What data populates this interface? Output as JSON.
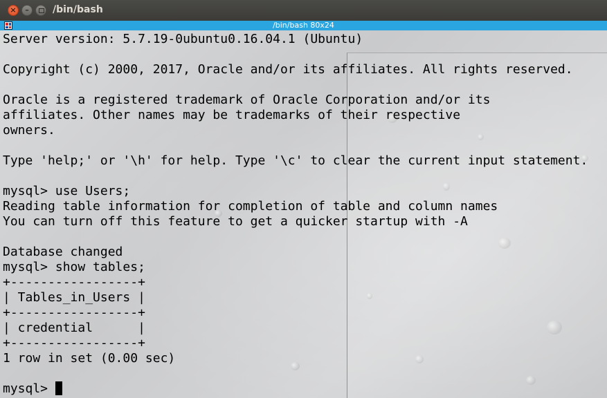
{
  "window": {
    "title": "/bin/bash",
    "close_glyph": "×",
    "minimize_glyph": "–",
    "icons": [
      "close-icon",
      "minimize-icon",
      "maximize-icon"
    ]
  },
  "terminal_bar": {
    "title": "/bin/bash 80x24",
    "icon": "terminal-app-icon",
    "color": "#2aa5e0"
  },
  "terminal": {
    "lines": [
      "Server version: 5.7.19-0ubuntu0.16.04.1 (Ubuntu)",
      "",
      "Copyright (c) 2000, 2017, Oracle and/or its affiliates. All rights reserved.",
      "",
      "Oracle is a registered trademark of Oracle Corporation and/or its",
      "affiliates. Other names may be trademarks of their respective",
      "owners.",
      "",
      "Type 'help;' or '\\h' for help. Type '\\c' to clear the current input statement.",
      "",
      "mysql> use Users;",
      "Reading table information for completion of table and column names",
      "You can turn off this feature to get a quicker startup with -A",
      "",
      "Database changed",
      "mysql> show tables;",
      "+-----------------+",
      "| Tables_in_Users |",
      "+-----------------+",
      "| credential      |",
      "+-----------------+",
      "1 row in set (0.00 sec)",
      ""
    ],
    "prompt": "mysql> ",
    "text_color": "#000000"
  }
}
